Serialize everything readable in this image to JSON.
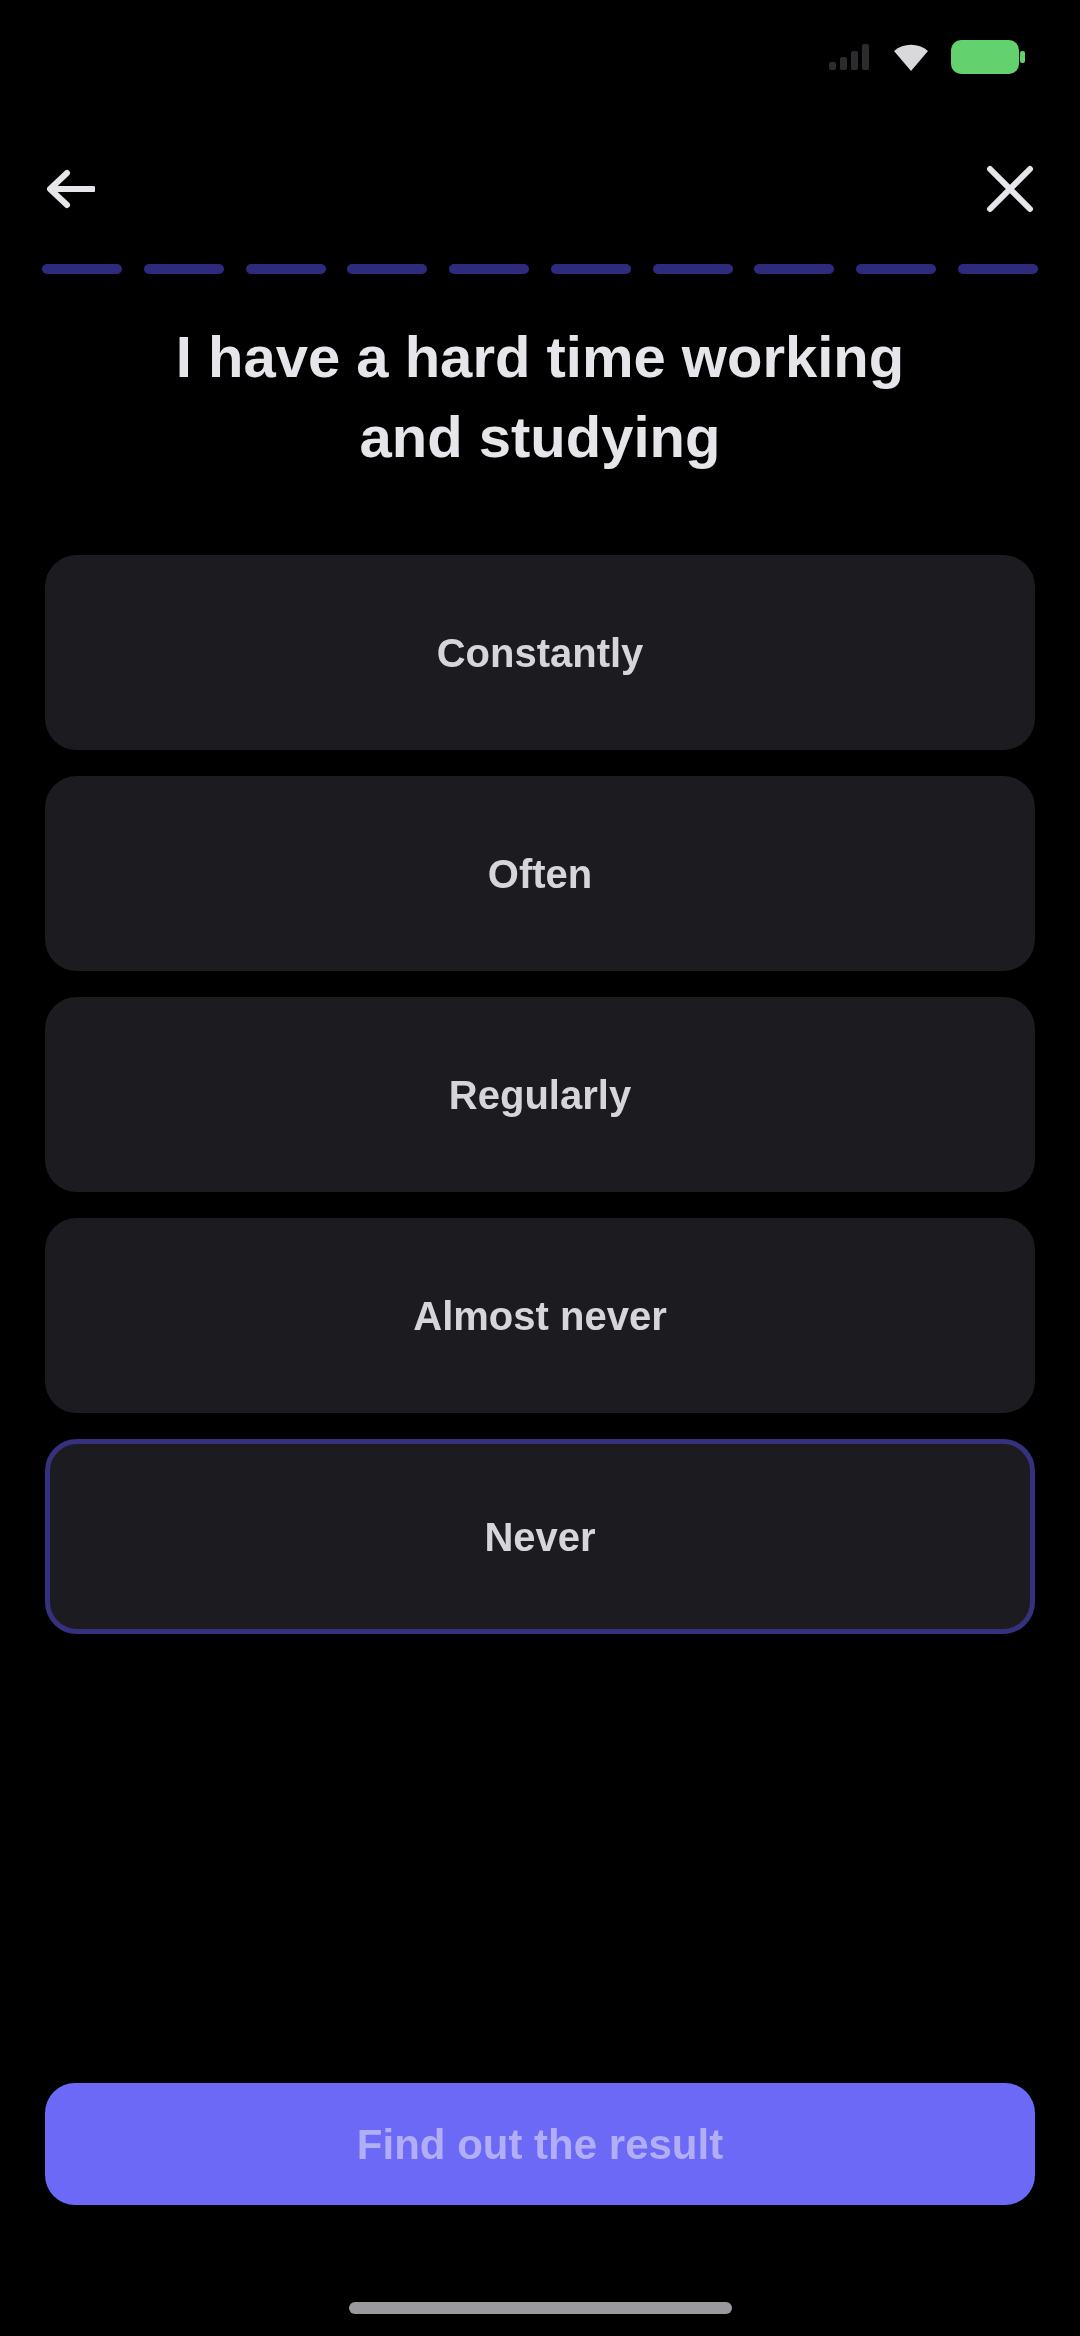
{
  "progress": {
    "segments": [
      {
        "filled": true
      },
      {
        "filled": true
      },
      {
        "filled": true
      },
      {
        "filled": true
      },
      {
        "filled": true
      },
      {
        "filled": true
      },
      {
        "filled": true
      },
      {
        "filled": true
      },
      {
        "filled": true
      },
      {
        "filled": true
      }
    ]
  },
  "question": {
    "title": "I have a hard time working and studying"
  },
  "options": [
    {
      "label": "Constantly",
      "selected": false
    },
    {
      "label": "Often",
      "selected": false
    },
    {
      "label": "Regularly",
      "selected": false
    },
    {
      "label": "Almost never",
      "selected": false
    },
    {
      "label": "Never",
      "selected": true
    }
  ],
  "primary_button": {
    "label": "Find out the result"
  }
}
